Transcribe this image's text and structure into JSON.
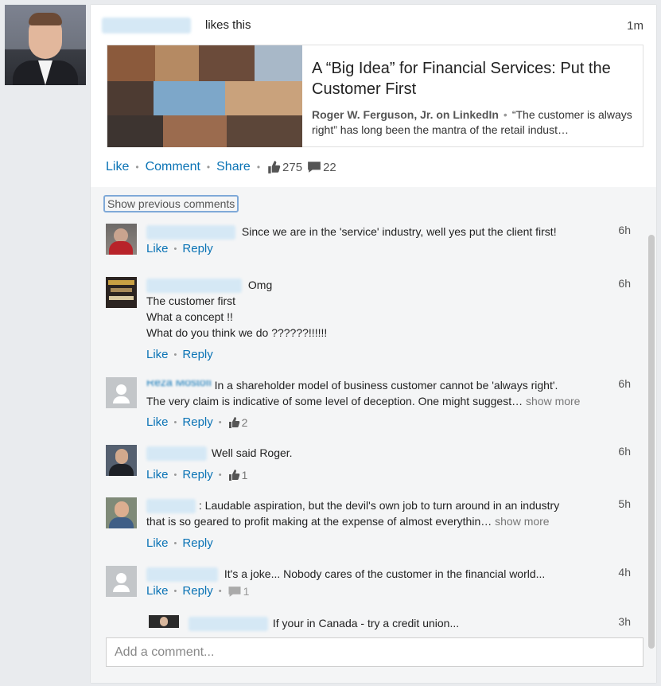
{
  "activity": {
    "likes_text": "likes this",
    "time": "1m"
  },
  "article": {
    "title": "A “Big Idea” for Financial Services: Put the Customer First",
    "source": "Roger W. Ferguson, Jr. on LinkedIn",
    "separator": "•",
    "snippet": "“The customer is always right” has long been the mantra of the retail indust…"
  },
  "actions": {
    "like": "Like",
    "comment": "Comment",
    "share": "Share",
    "separator": "•",
    "like_count": "275",
    "comment_count": "22"
  },
  "comments_section": {
    "show_previous": "Show previous comments",
    "add_placeholder": "Add a comment...",
    "like_label": "Like",
    "reply_label": "Reply",
    "separator": "•",
    "show_more": "show more",
    "comments": [
      {
        "text": "Since we are in the 'service' industry, well yes put the client first!",
        "time": "6h"
      },
      {
        "text_line1": "Omg",
        "text_line2": "The customer first",
        "text_line3": "What a concept !!",
        "text_line4": "What do you think we do ??????!!!!!!",
        "time": "6h"
      },
      {
        "name_fragment": "Reza Mostofi",
        "text_line1": "In a shareholder model of business customer cannot be 'always right'.",
        "text_line2": "The very claim is indicative of some level of deception. One might suggest…",
        "time": "6h",
        "likes": "2"
      },
      {
        "text": "Well said Roger.",
        "time": "6h",
        "likes": "1"
      },
      {
        "text_line1": ": Laudable aspiration, but the devil's own job to turn around in an industry",
        "text_line2": "that is so geared to profit making at the expense of almost everythin…",
        "time": "5h"
      },
      {
        "text": "It's a joke... Nobody cares of the customer in the financial world...",
        "time": "4h",
        "replies": "1"
      },
      {
        "text": "If your in Canada - try a credit union...",
        "time": "3h"
      }
    ]
  },
  "colors": {
    "link": "#0a73b5",
    "background": "#e9ebee",
    "comments_bg": "#f4f5f6"
  }
}
